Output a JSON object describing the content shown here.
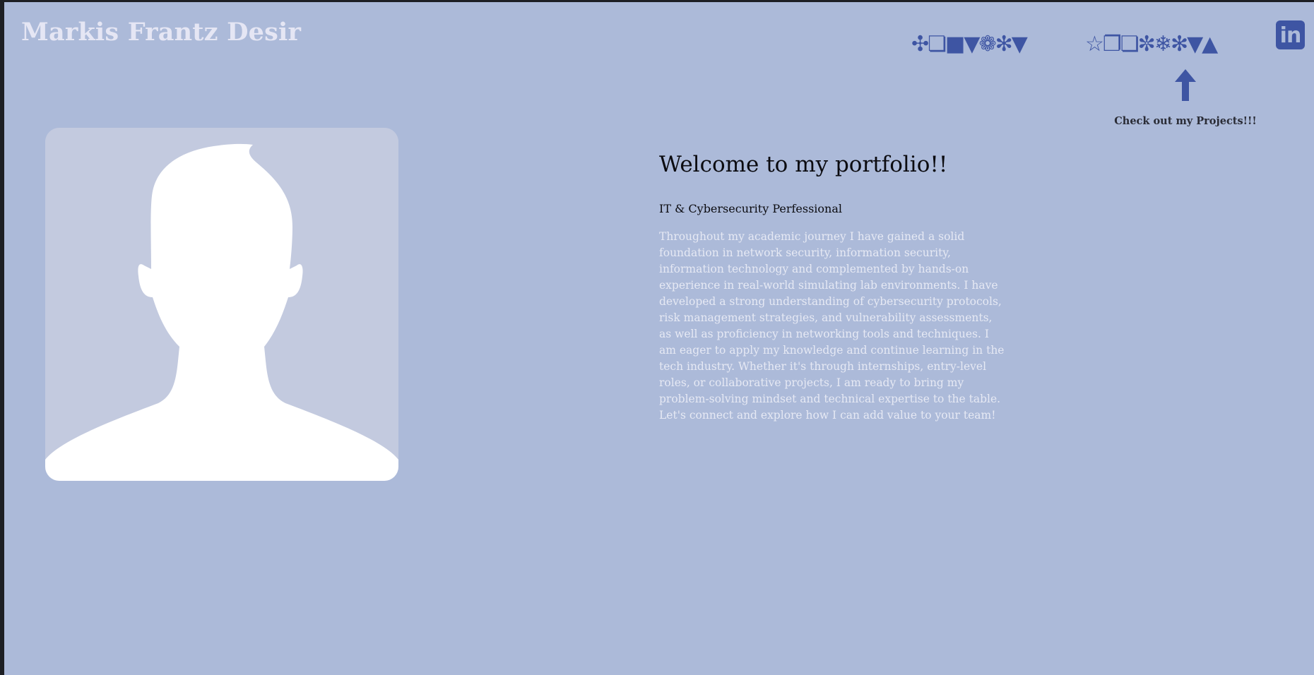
{
  "header": {
    "site_title": "Markis Frantz Desir",
    "nav": [
      {
        "label": "✣❏■▼❁✻▼"
      },
      {
        "label": "☆❐❏✼❄✻▼▲"
      }
    ],
    "linkedin_label": "in"
  },
  "projects_hint": "Check out my Projects!!!",
  "hero": {
    "welcome": "Welcome to my portfolio!!",
    "role": "IT & Cybersecurity Perfessional",
    "bio": "Throughout my academic journey I have gained a solid foundation in network security, information security, information technology and complemented by hands-on experience in real-world simulating lab environments. I have developed a strong understanding of cybersecurity protocols, risk management strategies, and vulnerability assessments, as well as proficiency in networking tools and techniques. I am eager to apply my knowledge and continue learning in the tech industry. Whether it's through internships, entry-level roles, or collaborative projects, I am ready to bring my problem-solving mindset and technical expertise to the table. Let's connect and explore how I can add value to your team!"
  },
  "icons": {
    "linkedin": "linkedin-icon",
    "arrow": "arrow-up-icon",
    "avatar": "default-avatar-silhouette"
  },
  "colors": {
    "background": "#acbad9",
    "accent": "#3e55a3",
    "title": "#e5e6f4",
    "avatar_bg": "#c3cadf"
  }
}
